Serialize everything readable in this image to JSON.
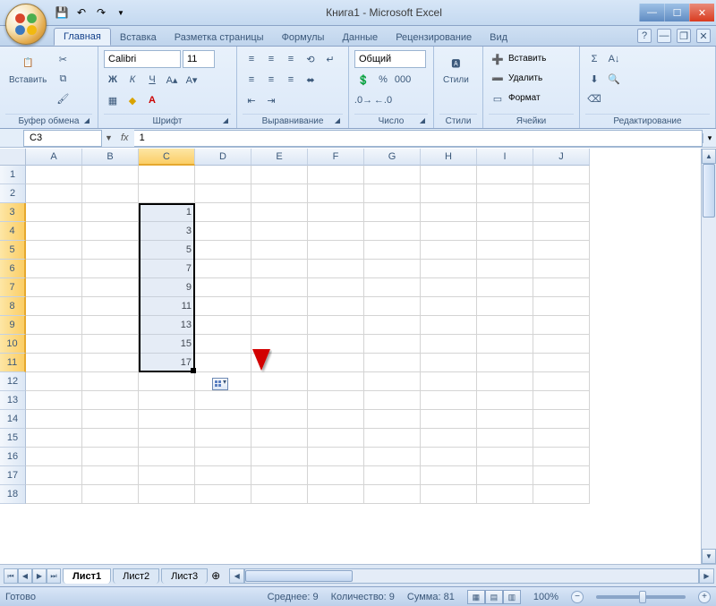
{
  "title": "Книга1 - Microsoft Excel",
  "tabs": {
    "home": "Главная",
    "insert": "Вставка",
    "layout": "Разметка страницы",
    "formulas": "Формулы",
    "data": "Данные",
    "review": "Рецензирование",
    "view": "Вид"
  },
  "groups": {
    "clipboard": "Буфер обмена",
    "font": "Шрифт",
    "alignment": "Выравнивание",
    "number": "Число",
    "styles": "Стили",
    "cells": "Ячейки",
    "editing": "Редактирование"
  },
  "paste_label": "Вставить",
  "styles_label": "Стили",
  "font": {
    "name": "Calibri",
    "size": "11"
  },
  "number_format": "Общий",
  "cells_menu": {
    "insert": "Вставить",
    "delete": "Удалить",
    "format": "Формат"
  },
  "namebox": "C3",
  "formula": "1",
  "columns": [
    "A",
    "B",
    "C",
    "D",
    "E",
    "F",
    "G",
    "H",
    "I",
    "J"
  ],
  "rows": 18,
  "selected_col_index": 2,
  "selected_rows": [
    3,
    4,
    5,
    6,
    7,
    8,
    9,
    10,
    11
  ],
  "cell_values": {
    "C3": "1",
    "C4": "3",
    "C5": "5",
    "C6": "7",
    "C7": "9",
    "C8": "11",
    "C9": "13",
    "C10": "15",
    "C11": "17"
  },
  "sheets": {
    "s1": "Лист1",
    "s2": "Лист2",
    "s3": "Лист3"
  },
  "status": {
    "ready": "Готово",
    "avg_label": "Среднее:",
    "avg": "9",
    "count_label": "Количество:",
    "count": "9",
    "sum_label": "Сумма:",
    "sum": "81",
    "zoom": "100%"
  }
}
